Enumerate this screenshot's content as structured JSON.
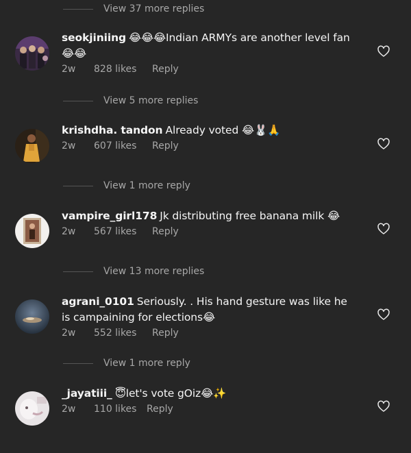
{
  "thread": [
    {
      "view_more": "View 37 more replies",
      "comment": null
    }
  ],
  "comments": [
    {
      "username": "seokjiniing",
      "text": "😂😂😂Indian ARMYs are another level fan 😂😂",
      "time": "2w",
      "likes": "828 likes",
      "reply": "Reply",
      "view_more": "View 5 more replies"
    },
    {
      "username": "krishdha. tandon",
      "text": "Already voted 😂🐰🙏",
      "time": "2w",
      "likes": "607 likes",
      "reply": "Reply",
      "view_more": "View 1 more reply"
    },
    {
      "username": "vampire_girl178",
      "text": "Jk distributing free banana milk 😂",
      "time": "2w",
      "likes": "567 likes",
      "reply": "Reply",
      "view_more": "View 13 more replies"
    },
    {
      "username": "agrani_0101",
      "text": "Seriously. .  His hand gesture was like he is campaining for elections😂",
      "time": "2w",
      "likes": "552 likes",
      "reply": "Reply",
      "view_more": "View 1 more reply"
    },
    {
      "username": "_jayatiii_",
      "text": "😇let's vote gOiz😂✨",
      "time": "2w",
      "likes": "110 likes",
      "reply": "Reply",
      "view_more": ""
    }
  ],
  "icons": {
    "heart": "heart-outline-icon"
  },
  "colors": {
    "background": "#262626",
    "primary_text": "#f5f5f5",
    "secondary_text": "#a8a8a8"
  }
}
